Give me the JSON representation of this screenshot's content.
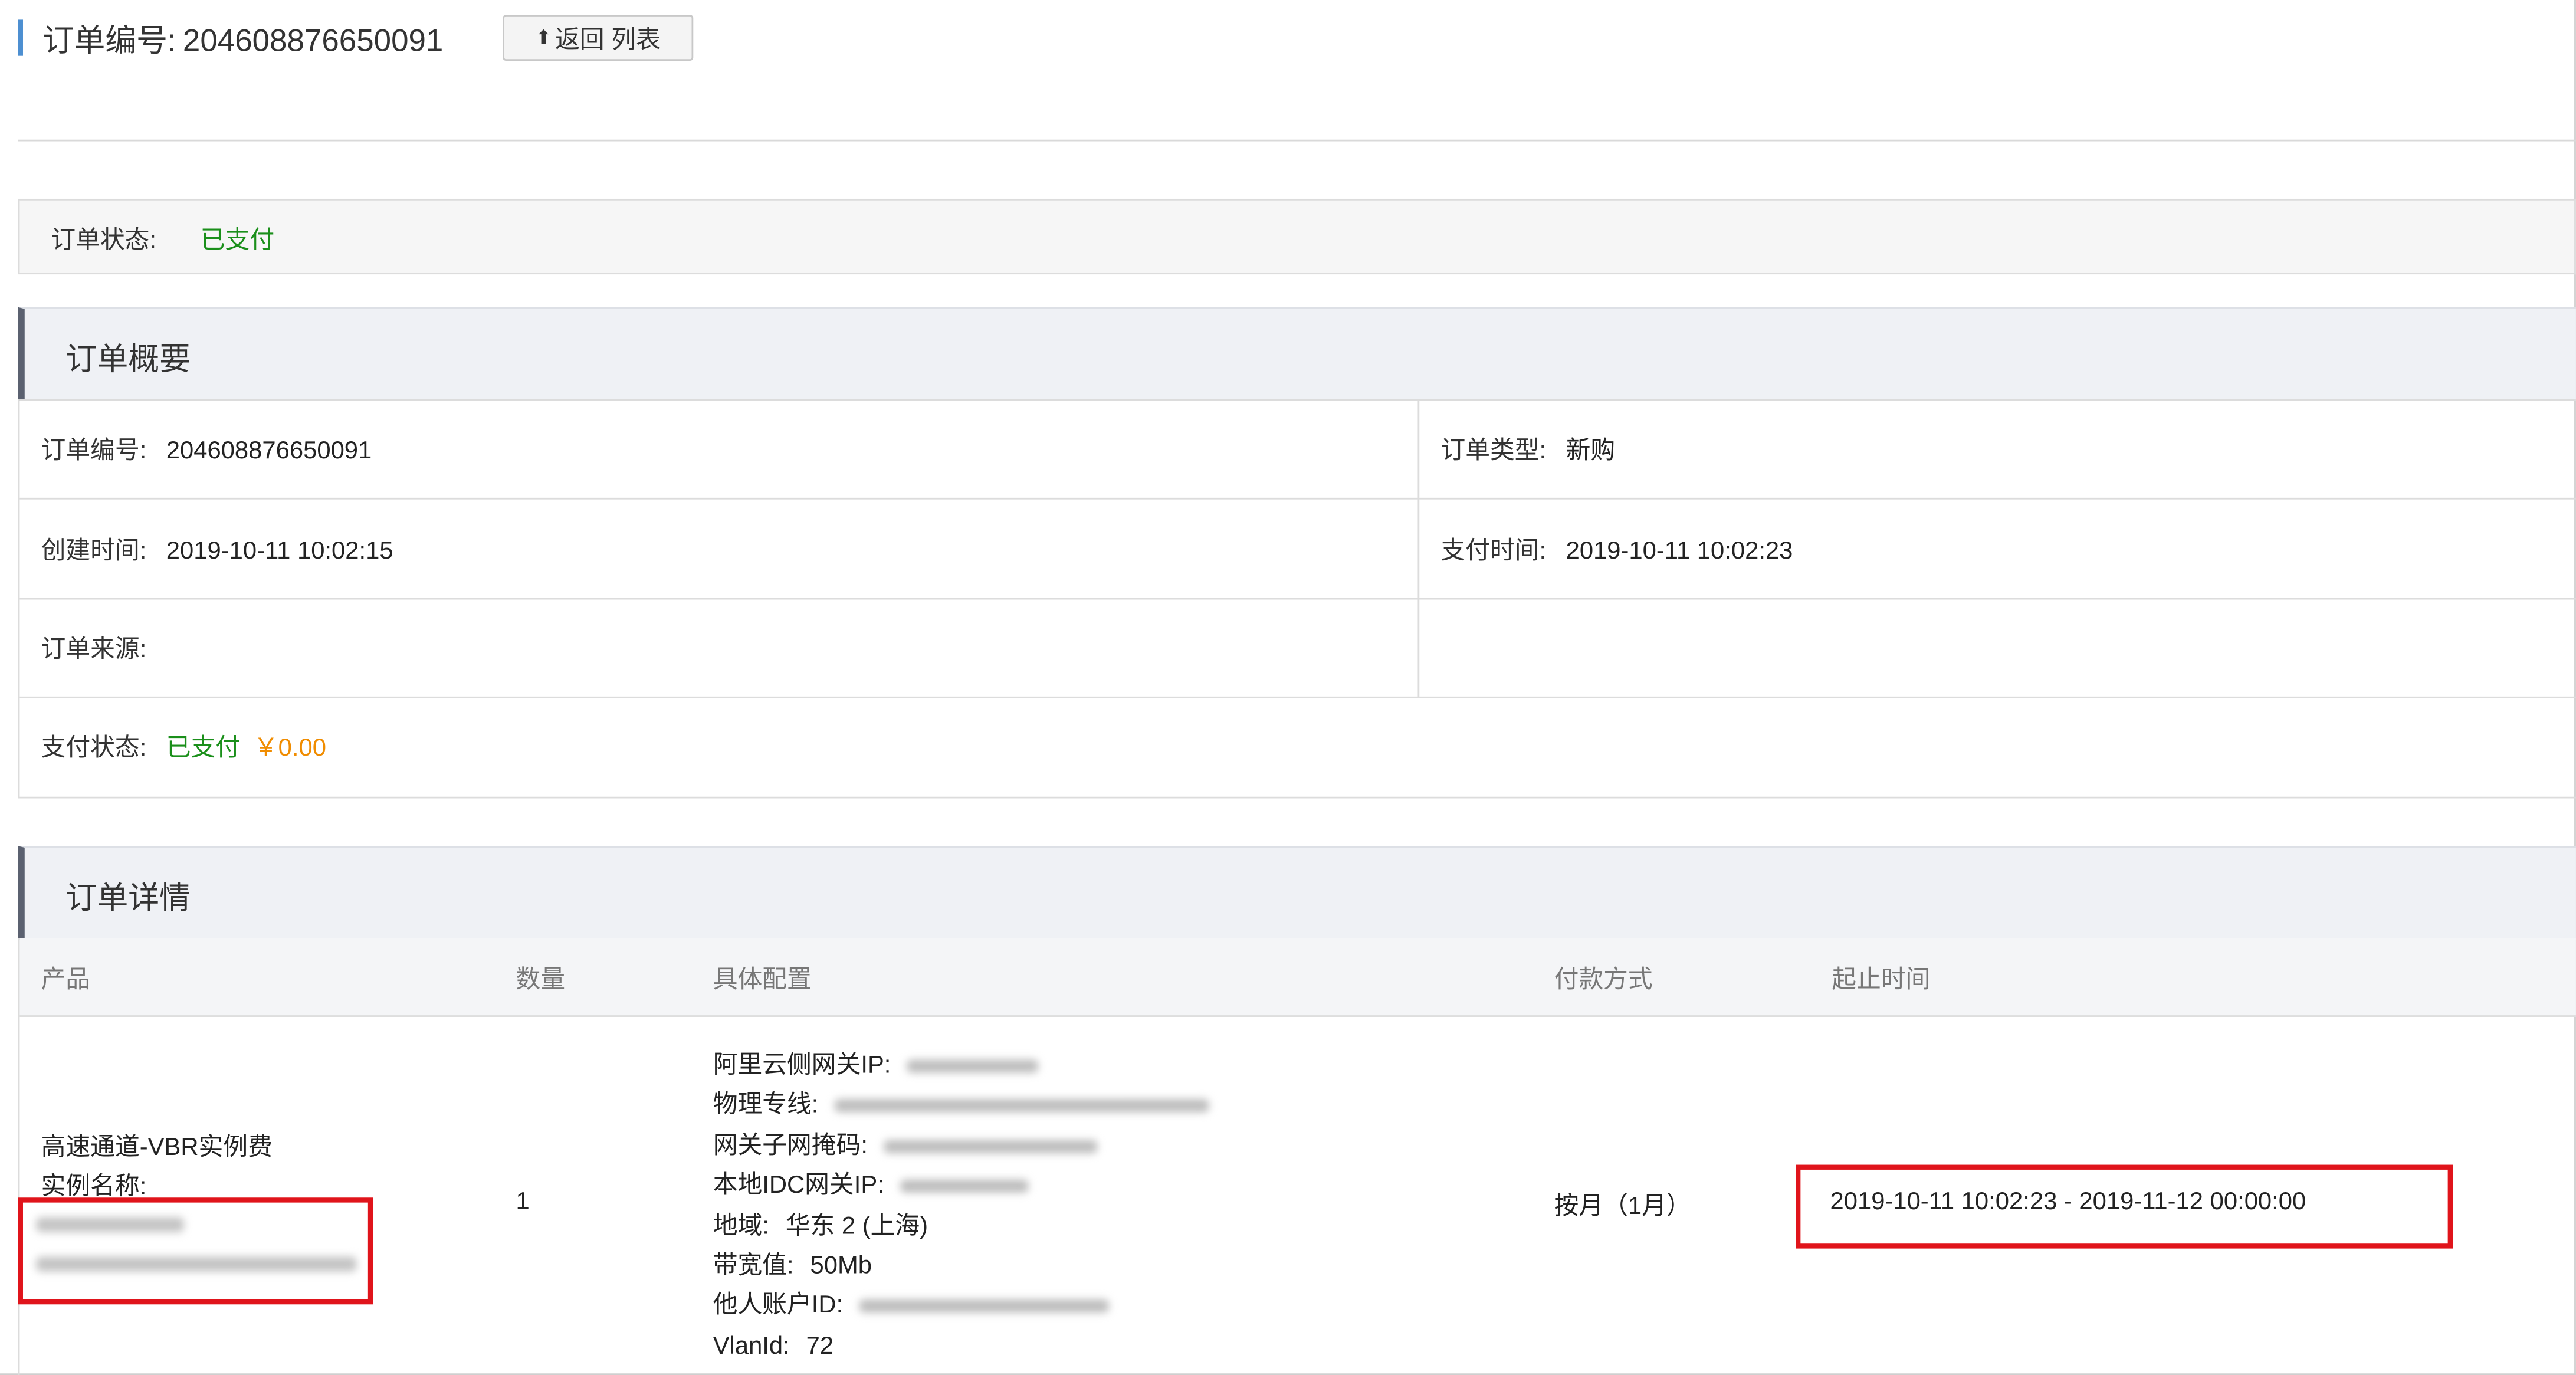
{
  "header": {
    "order_label": "订单编号:",
    "order_number": "204608876650091",
    "back_button": "返回 列表"
  },
  "status": {
    "label": "订单状态:",
    "value": "已支付"
  },
  "summary": {
    "section_title": "订单概要",
    "order_no_label": "订单编号:",
    "order_no_value": "204608876650091",
    "order_type_label": "订单类型:",
    "order_type_value": "新购",
    "created_label": "创建时间:",
    "created_value": "2019-10-11 10:02:15",
    "paid_time_label": "支付时间:",
    "paid_time_value": "2019-10-11 10:02:23",
    "source_label": "订单来源:",
    "pay_status_label": "支付状态:",
    "pay_status_value": "已支付",
    "pay_amount": "￥0.00"
  },
  "details": {
    "section_title": "订单详情",
    "columns": [
      "产品",
      "数量",
      "具体配置",
      "付款方式",
      "起止时间"
    ],
    "row": {
      "product_name": "高速通道-VBR实例费",
      "instance_label": "实例名称:",
      "quantity": "1",
      "config": {
        "gateway_ip_label": "阿里云侧网关IP:",
        "physical_line_label": "物理专线:",
        "subnet_mask_label": "网关子网掩码:",
        "idc_gateway_label": "本地IDC网关IP:",
        "region_label": "地域:",
        "region_value": "华东 2 (上海)",
        "bandwidth_label": "带宽值:",
        "bandwidth_value": "50Mb",
        "other_account_label": "他人账户ID:",
        "vlan_label": "VlanId:",
        "vlan_value": "72"
      },
      "payment_method": "按月（1月）",
      "period": "2019-10-11 10:02:23 - 2019-11-12 00:00:00"
    }
  },
  "colors": {
    "paid_green": "#1a8f1a",
    "amount_orange": "#f08c00",
    "highlight_red": "#e0141b",
    "accent_blue": "#4d8fd1"
  }
}
